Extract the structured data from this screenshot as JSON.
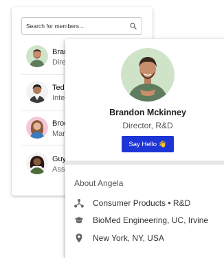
{
  "search": {
    "placeholder": "Search for members..."
  },
  "members": [
    {
      "name": "Brandon Mckinney",
      "role": "Director, R&D"
    },
    {
      "name": "Ted",
      "role": "Intern"
    },
    {
      "name": "Brooke",
      "role": "Manager"
    },
    {
      "name": "Guy",
      "role": "Associate"
    }
  ],
  "profile": {
    "name": "Brandon Mckinney",
    "title": "Director, R&D",
    "button_label": "Say Hello 👋"
  },
  "about": {
    "title": "About Angela",
    "items": [
      {
        "icon": "org-chart-icon",
        "text": "Consumer Products • R&D"
      },
      {
        "icon": "graduation-cap-icon",
        "text": "BioMed Engineering, UC, Irvine"
      },
      {
        "icon": "location-pin-icon",
        "text": "New York, NY, USA"
      }
    ]
  },
  "colors": {
    "accent": "#1e35d6",
    "avatar_bg_1": "#cfe3c9",
    "avatar_bg_3": "#f3c7d6"
  }
}
